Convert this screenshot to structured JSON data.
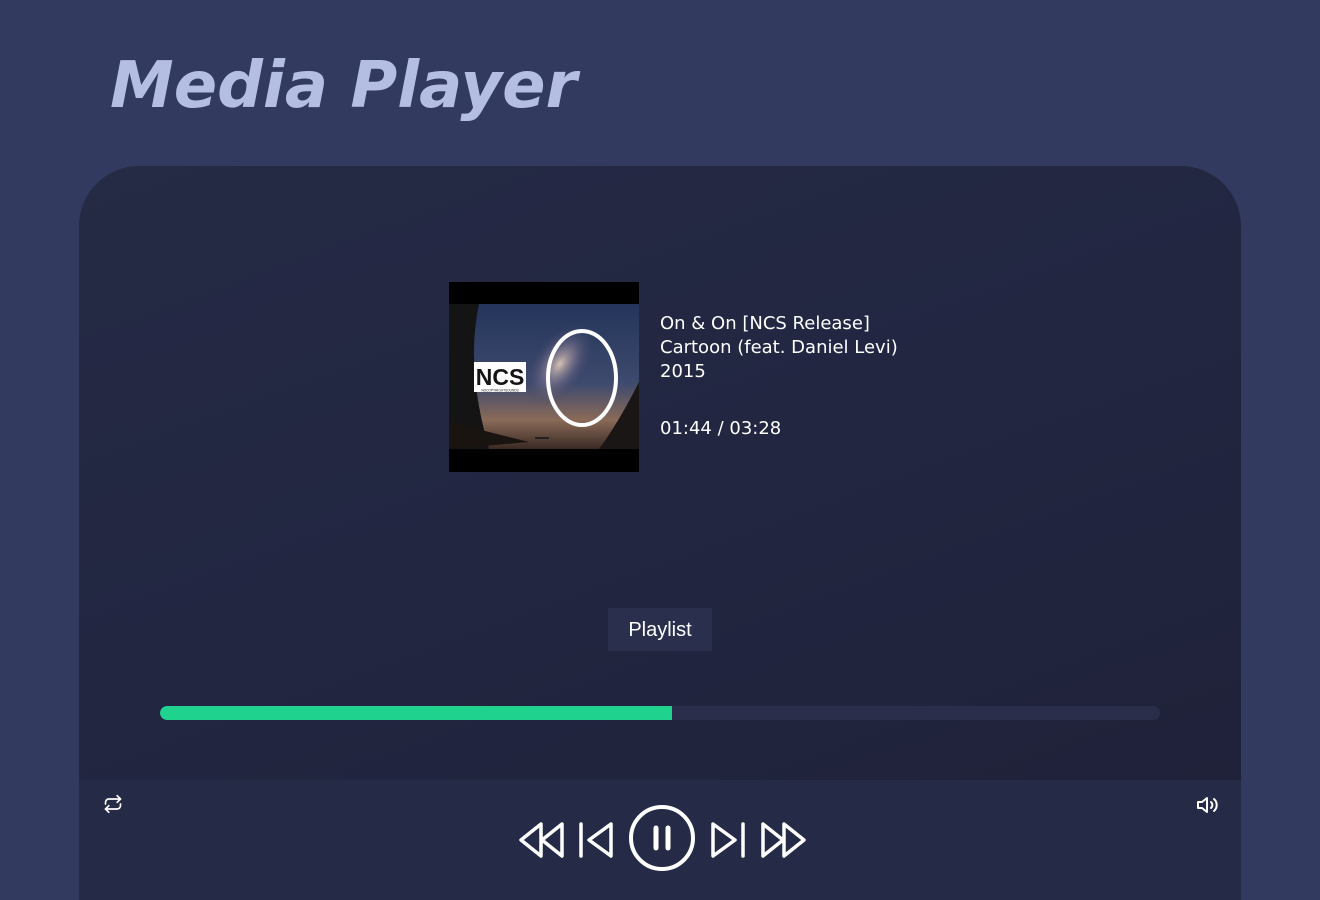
{
  "header": {
    "title": "Media Player"
  },
  "track": {
    "title": "On & On [NCS Release]",
    "artist": "Cartoon (feat. Daniel Levi)",
    "year": "2015",
    "current_time": "01:44",
    "duration": "03:28",
    "time_display": "01:44 / 03:28",
    "album_art_logo_text": "NCS",
    "album_art_subtext": "NOCOPYRIGHTSOUNDS"
  },
  "playlist": {
    "button_label": "Playlist"
  },
  "progress": {
    "fraction": 0.512,
    "fill_color": "#1fd28e",
    "track_color": "#2a2e4a"
  },
  "controls": {
    "repeat_icon": "repeat-icon",
    "fast_rewind_icon": "fast-rewind-icon",
    "previous_icon": "skip-previous-icon",
    "play_pause_icon": "pause-icon",
    "next_icon": "skip-next-icon",
    "fast_forward_icon": "fast-forward-icon",
    "volume_icon": "volume-icon"
  },
  "colors": {
    "background": "#323a60",
    "title": "#b4bee2",
    "player_panel": "#222641",
    "controls_bar": "#252a46",
    "accent": "#1fd28e"
  }
}
